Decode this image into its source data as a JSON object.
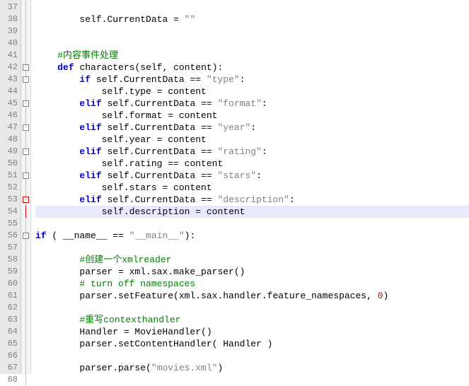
{
  "lines": [
    {
      "n": 37,
      "fold": "line",
      "html": "                                                       "
    },
    {
      "n": 38,
      "fold": "line",
      "html": "        <span class='self'>self</span>.CurrentData = <span class='str'>\"\"</span>"
    },
    {
      "n": 39,
      "fold": "line",
      "html": ""
    },
    {
      "n": 40,
      "fold": "line",
      "html": ""
    },
    {
      "n": 41,
      "fold": "line",
      "html": "    <span class='cmt'>#内容事件处理</span>"
    },
    {
      "n": 42,
      "fold": "box",
      "html": "    <span class='kw'>def</span> <span class='fn'>characters</span>(<span class='self'>self</span>, content):"
    },
    {
      "n": 43,
      "fold": "box",
      "html": "        <span class='kw'>if</span> <span class='self'>self</span>.CurrentData == <span class='str'>\"type\"</span>:"
    },
    {
      "n": 44,
      "fold": "line",
      "html": "            <span class='self'>self</span>.type = content"
    },
    {
      "n": 45,
      "fold": "box",
      "html": "        <span class='kw'>elif</span> <span class='self'>self</span>.CurrentData == <span class='str'>\"format\"</span>:"
    },
    {
      "n": 46,
      "fold": "line",
      "html": "            <span class='self'>self</span>.format = content"
    },
    {
      "n": 47,
      "fold": "box",
      "html": "        <span class='kw'>elif</span> <span class='self'>self</span>.CurrentData == <span class='str'>\"year\"</span>:"
    },
    {
      "n": 48,
      "fold": "line",
      "html": "            <span class='self'>self</span>.year = content"
    },
    {
      "n": 49,
      "fold": "box",
      "html": "        <span class='kw'>elif</span> <span class='self'>self</span>.CurrentData == <span class='str'>\"rating\"</span>:"
    },
    {
      "n": 50,
      "fold": "line",
      "html": "            <span class='self'>self</span>.rating == content"
    },
    {
      "n": 51,
      "fold": "box",
      "html": "        <span class='kw'>elif</span> <span class='self'>self</span>.CurrentData == <span class='str'>\"stars\"</span>:"
    },
    {
      "n": 52,
      "fold": "line",
      "html": "            <span class='self'>self</span>.stars = content"
    },
    {
      "n": 53,
      "fold": "redbox",
      "html": "        <span class='kw'>elif</span> <span class='self'>self</span>.CurrentData == <span class='str'>\"description\"</span>:"
    },
    {
      "n": 54,
      "fold": "redline",
      "hl": true,
      "html": "            <span class='self'>self</span>.description = content"
    },
    {
      "n": 55,
      "fold": "line",
      "html": ""
    },
    {
      "n": 56,
      "fold": "box",
      "html": "<span class='kw'>if</span> ( __name__ == <span class='str'>\"__main__\"</span>):"
    },
    {
      "n": 57,
      "fold": "line",
      "html": ""
    },
    {
      "n": 58,
      "fold": "line",
      "html": "        <span class='cmt'>#创建一个xmlreader</span>"
    },
    {
      "n": 59,
      "fold": "line",
      "html": "        parser = xml.sax.make_parser()"
    },
    {
      "n": 60,
      "fold": "line",
      "html": "        <span class='cmt'># turn off namespaces</span>"
    },
    {
      "n": 61,
      "fold": "line",
      "html": "        parser.setFeature(xml.sax.handler.feature_namespaces, <span class='num'>0</span>)"
    },
    {
      "n": 62,
      "fold": "line",
      "html": ""
    },
    {
      "n": 63,
      "fold": "line",
      "html": "        <span class='cmt'>#重写contexthandler</span>"
    },
    {
      "n": 64,
      "fold": "line",
      "html": "        Handler = MovieHandler()"
    },
    {
      "n": 65,
      "fold": "line",
      "html": "        parser.setContentHandler( Handler )"
    },
    {
      "n": 66,
      "fold": "line",
      "html": ""
    },
    {
      "n": 67,
      "fold": "line",
      "html": "        parser.parse(<span class='str'>\"movies.xml\"</span>)"
    },
    {
      "n": 68,
      "fold": "line",
      "html": ""
    }
  ]
}
